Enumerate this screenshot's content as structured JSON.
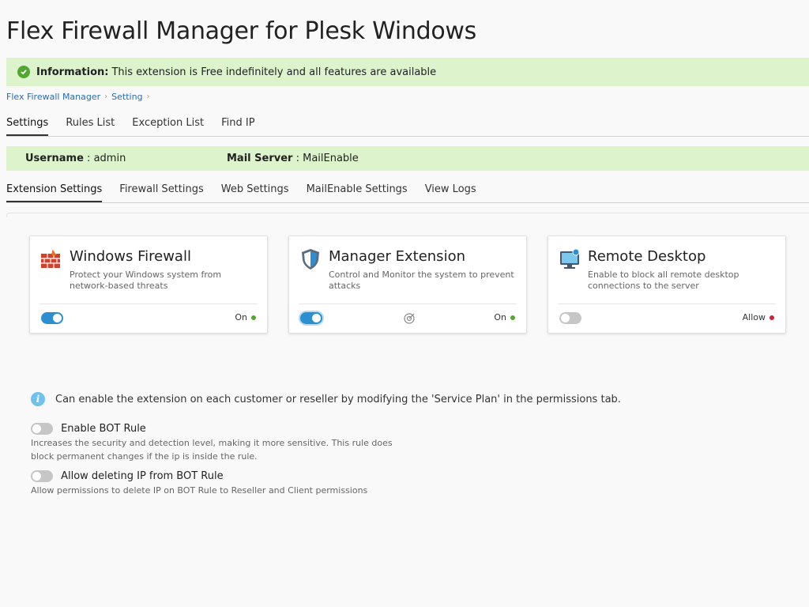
{
  "page": {
    "title": "Flex Firewall Manager for Plesk Windows"
  },
  "info": {
    "label": "Information:",
    "text": "This extension is Free indefinitely and all features are available"
  },
  "breadcrumb": [
    {
      "label": "Flex Firewall Manager"
    },
    {
      "label": "Setting"
    }
  ],
  "main_tabs": [
    {
      "label": "Settings",
      "active": true
    },
    {
      "label": "Rules List"
    },
    {
      "label": "Exception List"
    },
    {
      "label": "Find IP"
    }
  ],
  "user_strip": {
    "username_label": "Username",
    "username_value": "admin",
    "mail_label": "Mail Server",
    "mail_value": "MailEnable"
  },
  "sub_tabs": [
    {
      "label": "Extension Settings",
      "active": true
    },
    {
      "label": "Firewall Settings"
    },
    {
      "label": "Web Settings"
    },
    {
      "label": "MailEnable Settings"
    },
    {
      "label": "View Logs"
    }
  ],
  "cards": [
    {
      "icon": "firewall-icon",
      "title": "Windows Firewall",
      "desc": "Protect your Windows system from network-based threats",
      "toggle": "on",
      "status": "On",
      "status_color": "#53a730"
    },
    {
      "icon": "shield-icon",
      "title": "Manager Extension",
      "desc": "Control and Monitor the system to prevent attacks",
      "toggle": "on",
      "status": "On",
      "status_color": "#53a730",
      "mid_icon": "target-icon"
    },
    {
      "icon": "monitor-icon",
      "title": "Remote Desktop",
      "desc": "Enable to block all remote desktop connections to the server",
      "toggle": "off",
      "status": "Allow",
      "status_color": "#d0223e"
    }
  ],
  "note": {
    "text": "Can enable the extension on each customer or reseller by modifying the 'Service Plan' in the permissions tab."
  },
  "options": [
    {
      "label": "Enable BOT Rule",
      "desc": "Increases the security and detection level, making it more sensitive. This rule does block permanent changes if the ip is inside the rule.",
      "toggle": "off"
    },
    {
      "label": "Allow deleting IP from BOT Rule",
      "desc": "Allow permissions to delete IP on BOT Rule to Reseller and Client permissions",
      "toggle": "off"
    }
  ],
  "colors": {
    "accent": "#2e8fd0",
    "banner_bg": "#dcf3cc",
    "ok": "#53a730",
    "alert": "#d0223e"
  }
}
